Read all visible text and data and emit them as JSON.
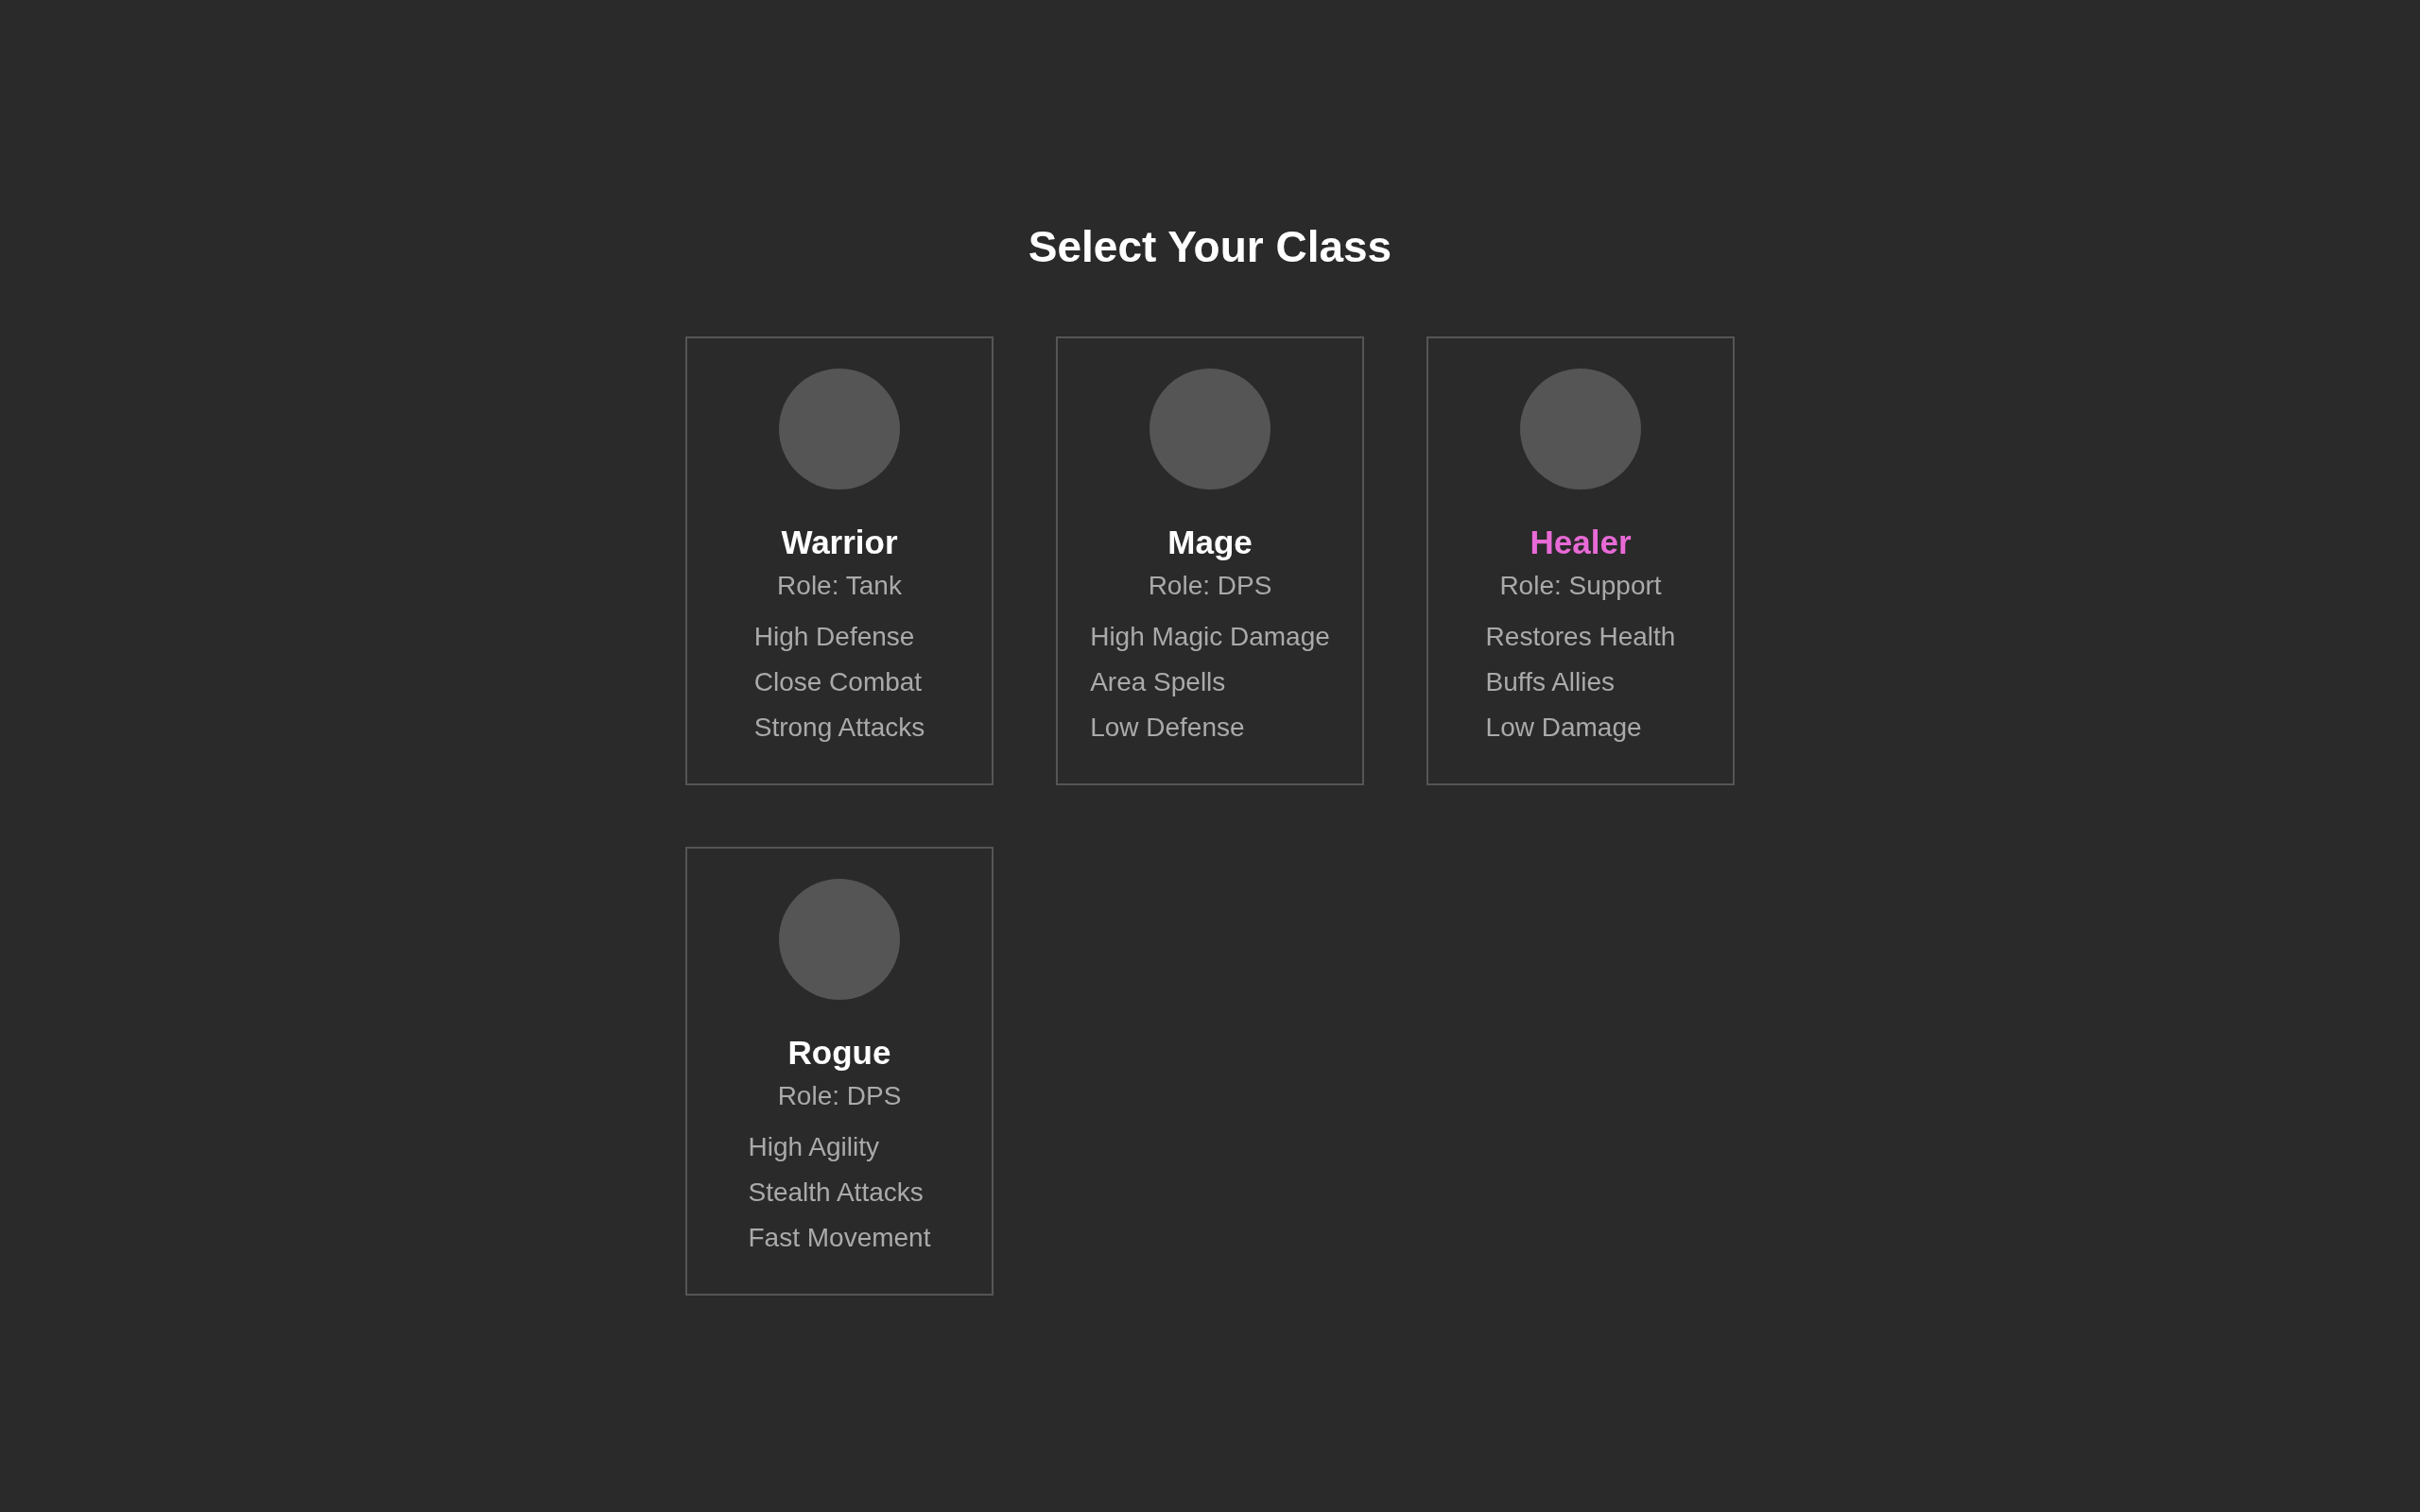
{
  "title": "Select Your Class",
  "classes": [
    {
      "name": "Warrior",
      "role": "Role: Tank",
      "traits": [
        "High Defense",
        "Close Combat",
        "Strong Attacks"
      ],
      "selected": false
    },
    {
      "name": "Mage",
      "role": "Role: DPS",
      "traits": [
        "High Magic Damage",
        "Area Spells",
        "Low Defense"
      ],
      "selected": false
    },
    {
      "name": "Healer",
      "role": "Role: Support",
      "traits": [
        "Restores Health",
        "Buffs Allies",
        "Low Damage"
      ],
      "selected": true
    },
    {
      "name": "Rogue",
      "role": "Role: DPS",
      "traits": [
        "High Agility",
        "Stealth Attacks",
        "Fast Movement"
      ],
      "selected": false
    }
  ]
}
